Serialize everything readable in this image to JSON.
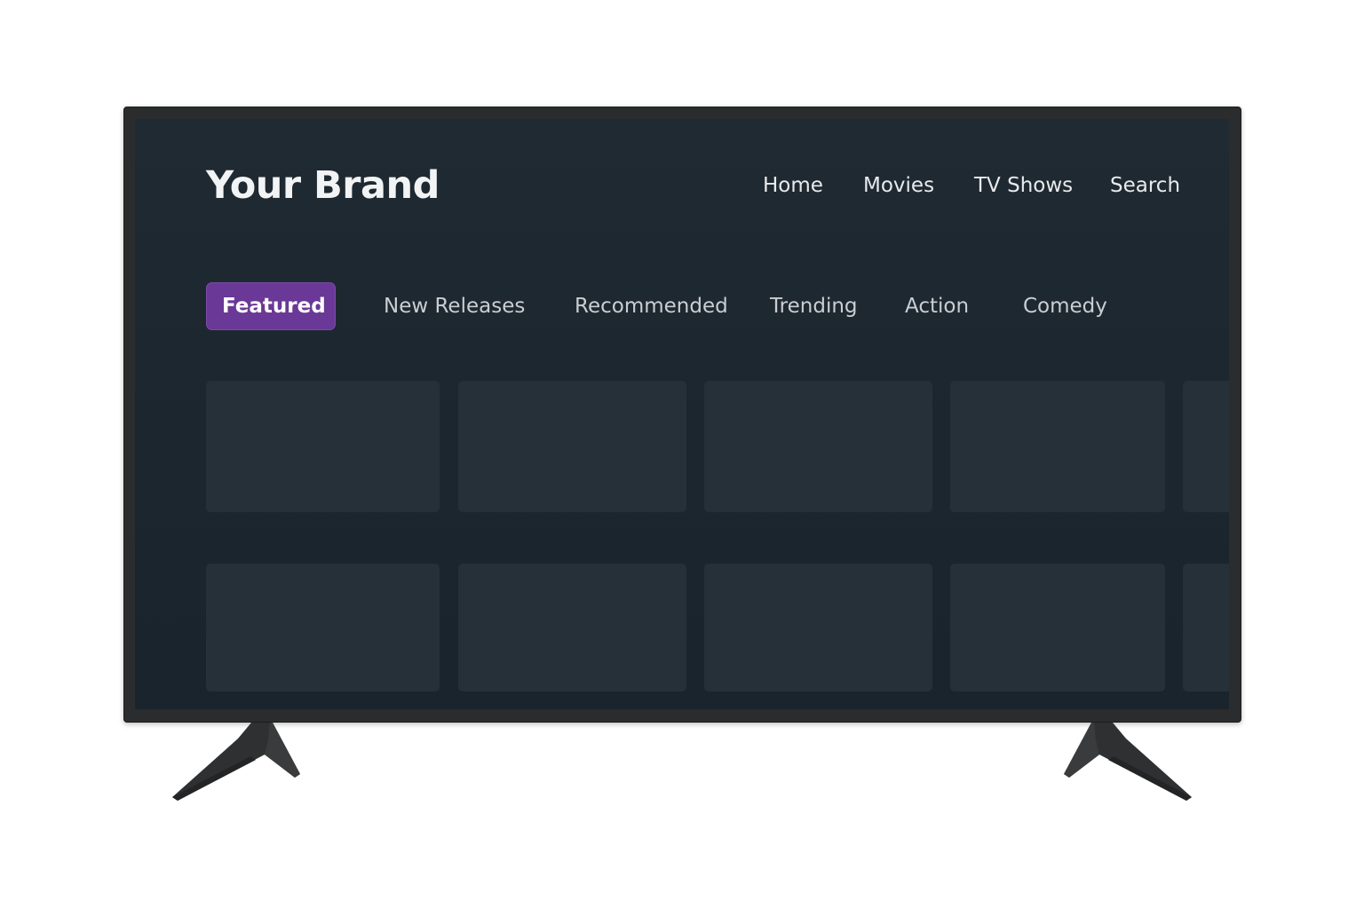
{
  "brand": {
    "name": "Your Brand"
  },
  "nav": {
    "items": [
      {
        "label": "Home"
      },
      {
        "label": "Movies"
      },
      {
        "label": "TV Shows"
      },
      {
        "label": "Search"
      }
    ]
  },
  "tabs": {
    "items": [
      {
        "label": "Featured",
        "active": true
      },
      {
        "label": "New Releases",
        "active": false
      },
      {
        "label": "Recommended",
        "active": false
      },
      {
        "label": "Trending",
        "active": false
      },
      {
        "label": "Action",
        "active": false
      },
      {
        "label": "Comedy",
        "active": false
      }
    ]
  },
  "content": {
    "rows": [
      {
        "tile_count": 5
      },
      {
        "tile_count": 5
      }
    ]
  },
  "colors": {
    "screen_background": "#1e2830",
    "tile": "#253039",
    "active_tab": "#6a3896",
    "text": "#e8eaec",
    "tv_bezel": "#2b2c2d"
  }
}
